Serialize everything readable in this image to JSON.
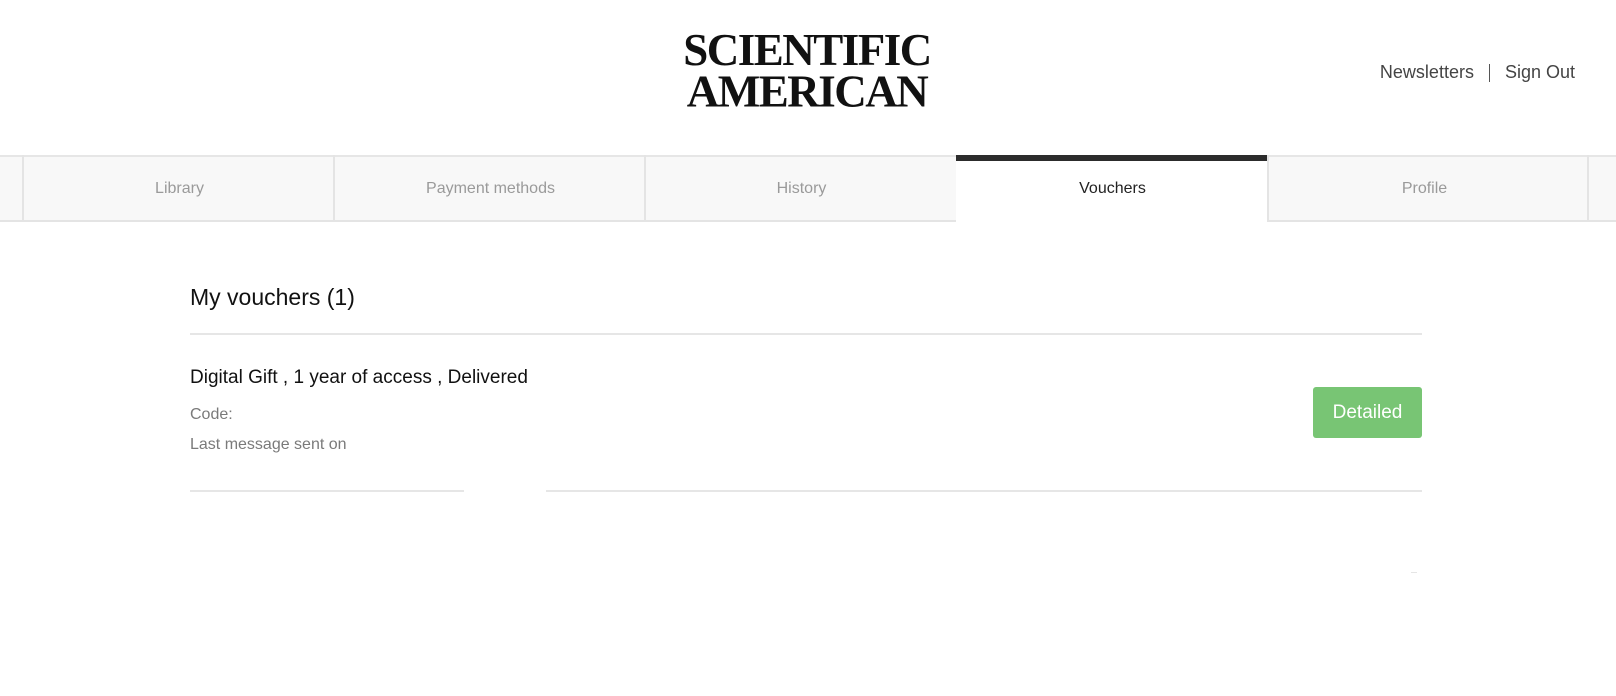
{
  "brand": {
    "logo_line1": "SCIENTIFIC",
    "logo_line2": "AMERICAN"
  },
  "top_nav": {
    "newsletters": "Newsletters",
    "sign_out": "Sign Out"
  },
  "tabs": [
    {
      "label": "Library",
      "active": false
    },
    {
      "label": "Payment methods",
      "active": false
    },
    {
      "label": "History",
      "active": false
    },
    {
      "label": "Vouchers",
      "active": true
    },
    {
      "label": "Profile",
      "active": false
    }
  ],
  "vouchers": {
    "title": "My vouchers (1)",
    "items": [
      {
        "title": "Digital Gift , 1 year of access , Delivered",
        "code_label": "Code:",
        "last_message_label": "Last message sent on",
        "button_label": "Detailed"
      }
    ]
  },
  "colors": {
    "accent_green": "#78c574",
    "active_tab_bar": "#2c2c2c",
    "tab_background": "#f8f8f8"
  }
}
